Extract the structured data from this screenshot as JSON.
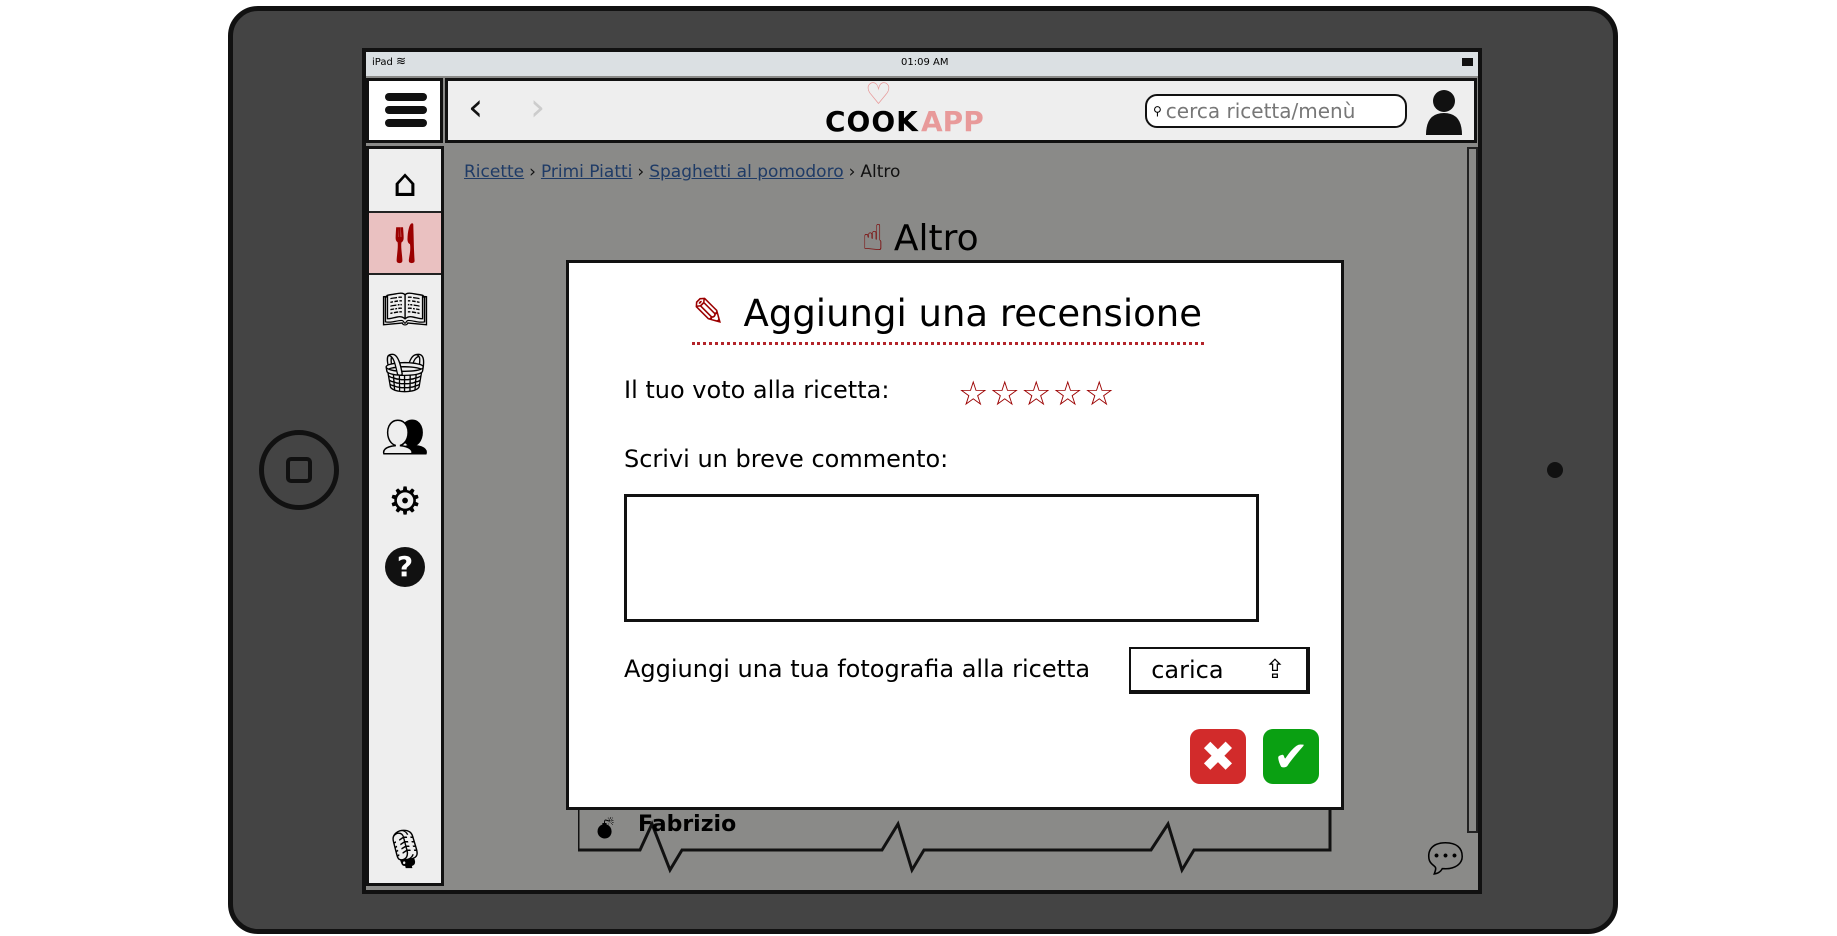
{
  "status_bar": {
    "device": "iPad",
    "time": "01:09 AM"
  },
  "header": {
    "logo_text_1": "COOK",
    "logo_text_2": "APP",
    "search_placeholder": "cerca ricetta/menù"
  },
  "sidebar": {
    "items": [
      {
        "icon": "home-icon",
        "label": "Home"
      },
      {
        "icon": "cutlery-icon",
        "label": "Ricette",
        "active": true
      },
      {
        "icon": "book-icon",
        "label": "Libro"
      },
      {
        "icon": "basket-icon",
        "label": "Spesa"
      },
      {
        "icon": "group-icon",
        "label": "Community"
      },
      {
        "icon": "gear-icon",
        "label": "Impostazioni"
      },
      {
        "icon": "help-icon",
        "label": "Aiuto"
      }
    ]
  },
  "breadcrumb": [
    "Ricette",
    "Primi Piatti",
    "Spaghetti al pomodoro",
    "Altro"
  ],
  "page_title": "Altro",
  "background_comment_author": "Fabrizio",
  "modal": {
    "title": "Aggiungi una recensione",
    "rating_label": "Il tuo voto alla ricetta:",
    "rating_value": 0,
    "rating_max": 5,
    "comment_label": "Scrivi un breve commento:",
    "comment_value": "",
    "photo_label": "Aggiungi una tua fotografia alla ricetta",
    "upload_label": "carica"
  },
  "colors": {
    "accent": "#9b0000",
    "cancel": "#d22b2b",
    "confirm": "#0aa012",
    "highlight": "#eac1c1"
  }
}
